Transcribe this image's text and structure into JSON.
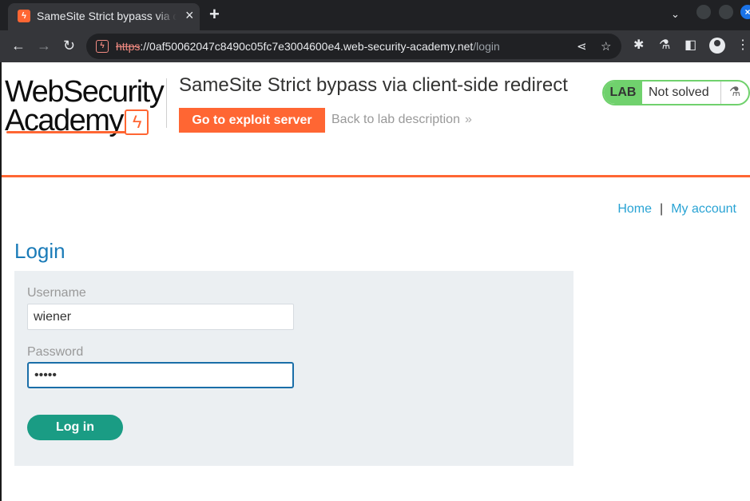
{
  "browser": {
    "tab_title": "SameSite Strict bypass via client-side redirect",
    "tab_close_glyph": "×",
    "new_tab_glyph": "+",
    "url_scheme": "https",
    "url_host": "://0af50062047c8490c05fc7e3004600e4.web-security-academy.net",
    "url_path": "/login"
  },
  "header": {
    "logo_line1": "WebSecurity",
    "logo_line2": "Academy",
    "lab_title": "SameSite Strict bypass via client-side redirect",
    "exploit_button": "Go to exploit server",
    "back_link": "Back to lab description",
    "status_badge": "LAB",
    "status_text": "Not solved",
    "accent_color": "#ff6633"
  },
  "nav": {
    "home": "Home",
    "separator": "|",
    "my_account": "My account"
  },
  "login": {
    "title": "Login",
    "username_label": "Username",
    "username_value": "wiener",
    "password_label": "Password",
    "password_value": "•••••",
    "submit_label": "Log in"
  },
  "icons": {
    "tab_favicon": "lightning-bolt-icon",
    "back": "arrow-left-icon",
    "forward": "arrow-right-icon",
    "reload": "reload-icon",
    "security": "not-secure-icon",
    "share": "share-icon",
    "bookmark": "star-icon",
    "extensions": "puzzle-icon",
    "labs": "flask-icon",
    "sidepanel": "sidepanel-icon",
    "profile": "profile-icon",
    "menu": "kebab-menu-icon"
  }
}
